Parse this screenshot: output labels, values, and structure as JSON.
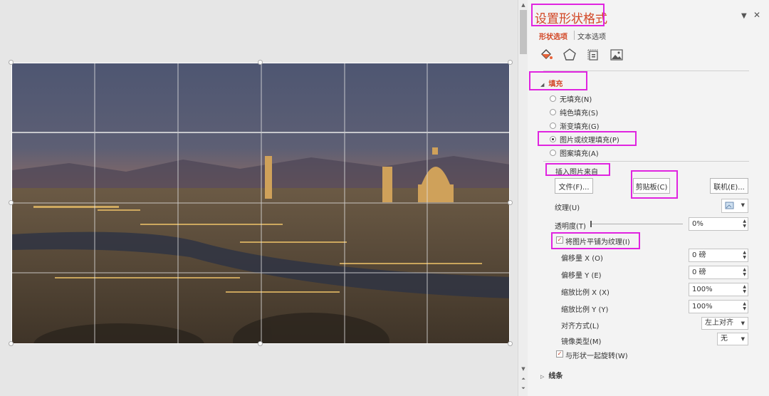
{
  "panel": {
    "title": "设置形状格式",
    "tabs": {
      "shape": "形状选项",
      "text": "文本选项"
    },
    "icons": [
      "fill-line-icon",
      "effects-pentagon-icon",
      "size-properties-icon",
      "picture-icon"
    ]
  },
  "fill": {
    "section_label": "填充",
    "options": [
      {
        "label": "无填充(N)",
        "selected": false
      },
      {
        "label": "纯色填充(S)",
        "selected": false
      },
      {
        "label": "渐变填充(G)",
        "selected": false
      },
      {
        "label": "图片或纹理填充(P)",
        "selected": true
      },
      {
        "label": "图案填充(A)",
        "selected": false
      }
    ],
    "insert_from_label": "插入图片来自",
    "buttons": {
      "file": "文件(F)...",
      "clipboard": "剪贴板(C)",
      "online": "联机(E)..."
    },
    "texture_label": "纹理(U)",
    "transparency_label": "透明度(T)",
    "transparency_value": "0%",
    "tile_label": "将图片平铺为纹理(I)",
    "tile_checked": true,
    "offset_x_label": "偏移量 X (O)",
    "offset_x_value": "0 磅",
    "offset_y_label": "偏移量 Y (E)",
    "offset_y_value": "0 磅",
    "scale_x_label": "缩放比例 X (X)",
    "scale_x_value": "100%",
    "scale_y_label": "缩放比例 Y (Y)",
    "scale_y_value": "100%",
    "align_label": "对齐方式(L)",
    "align_value": "左上对齐",
    "mirror_label": "镜像类型(M)",
    "mirror_value": "无",
    "rotate_label": "与形状一起旋转(W)",
    "rotate_checked": true
  },
  "line_section_label": "线条",
  "colors": {
    "accent": "#d24726",
    "highlight": "#e024e0"
  }
}
